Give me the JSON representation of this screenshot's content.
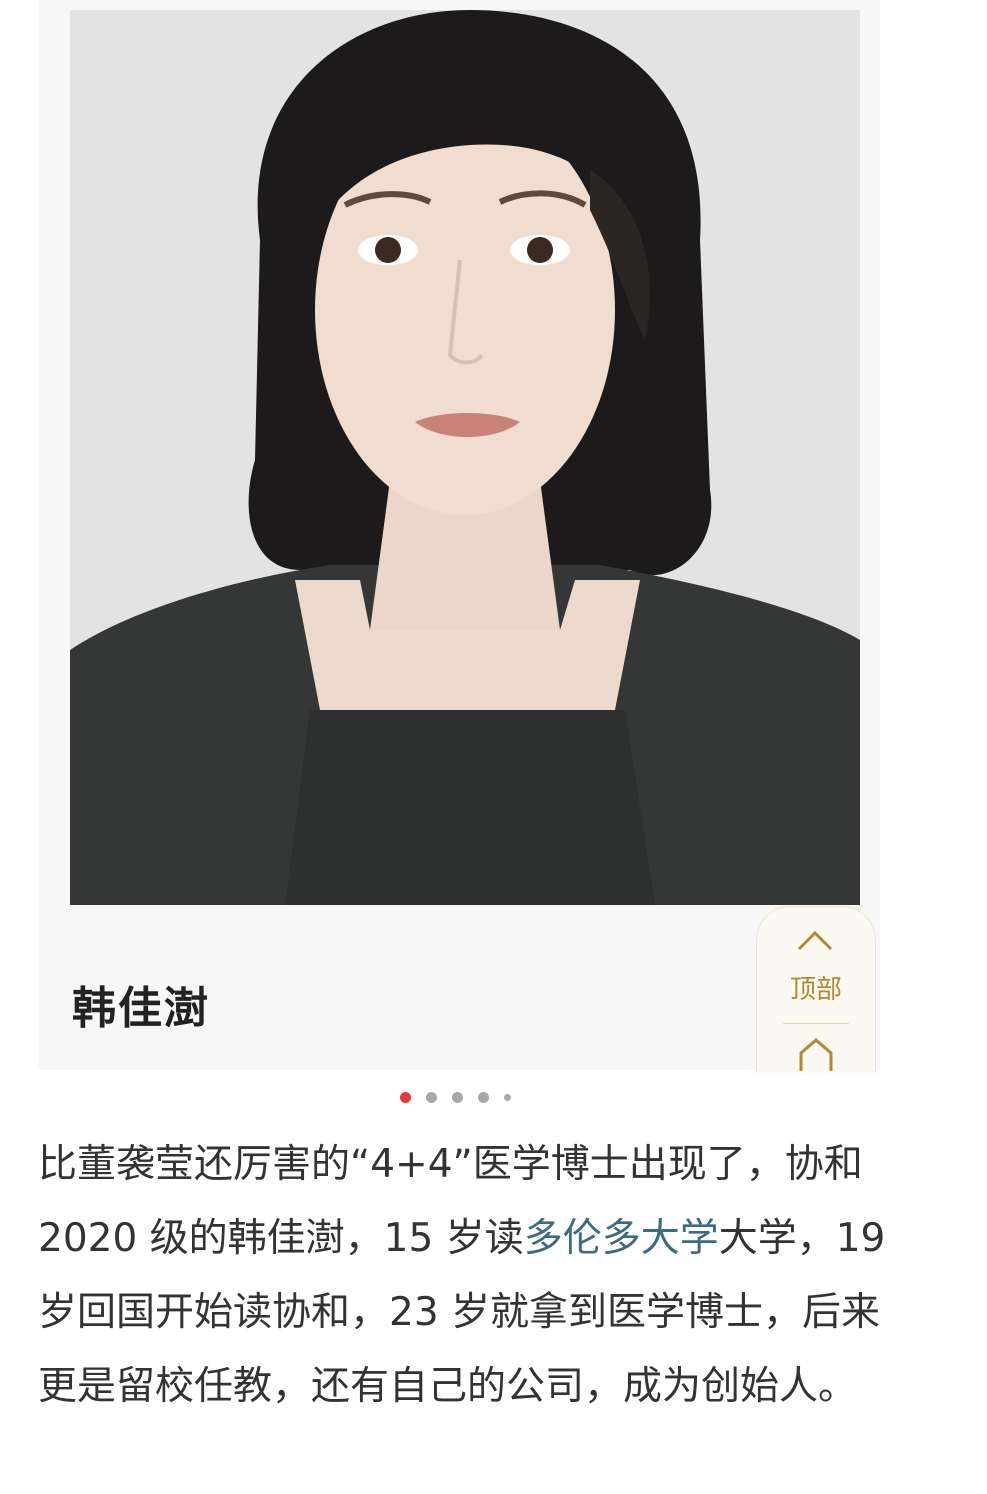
{
  "post": {
    "name": "韩佳澍",
    "top_button": {
      "label": "顶部",
      "icon": "chevron-up-icon",
      "secondary_icon": "home-icon"
    },
    "carousel": {
      "total": 5,
      "active_index": 0
    },
    "text": {
      "part1": "比董袭莹还厉害的“4+4”医学博士出现了，协和 2020 级的韩佳澍，15 岁读",
      "link": "多伦多大学",
      "part2": "大学，19 岁回国开始读协和，23 岁就拿到医学博士，后来更是留校任教，还有自己的公司，成为创始人。"
    }
  },
  "colors": {
    "dot_active": "#e5383b",
    "link": "#3d6b82",
    "accent_gold": "#b08a2e"
  }
}
